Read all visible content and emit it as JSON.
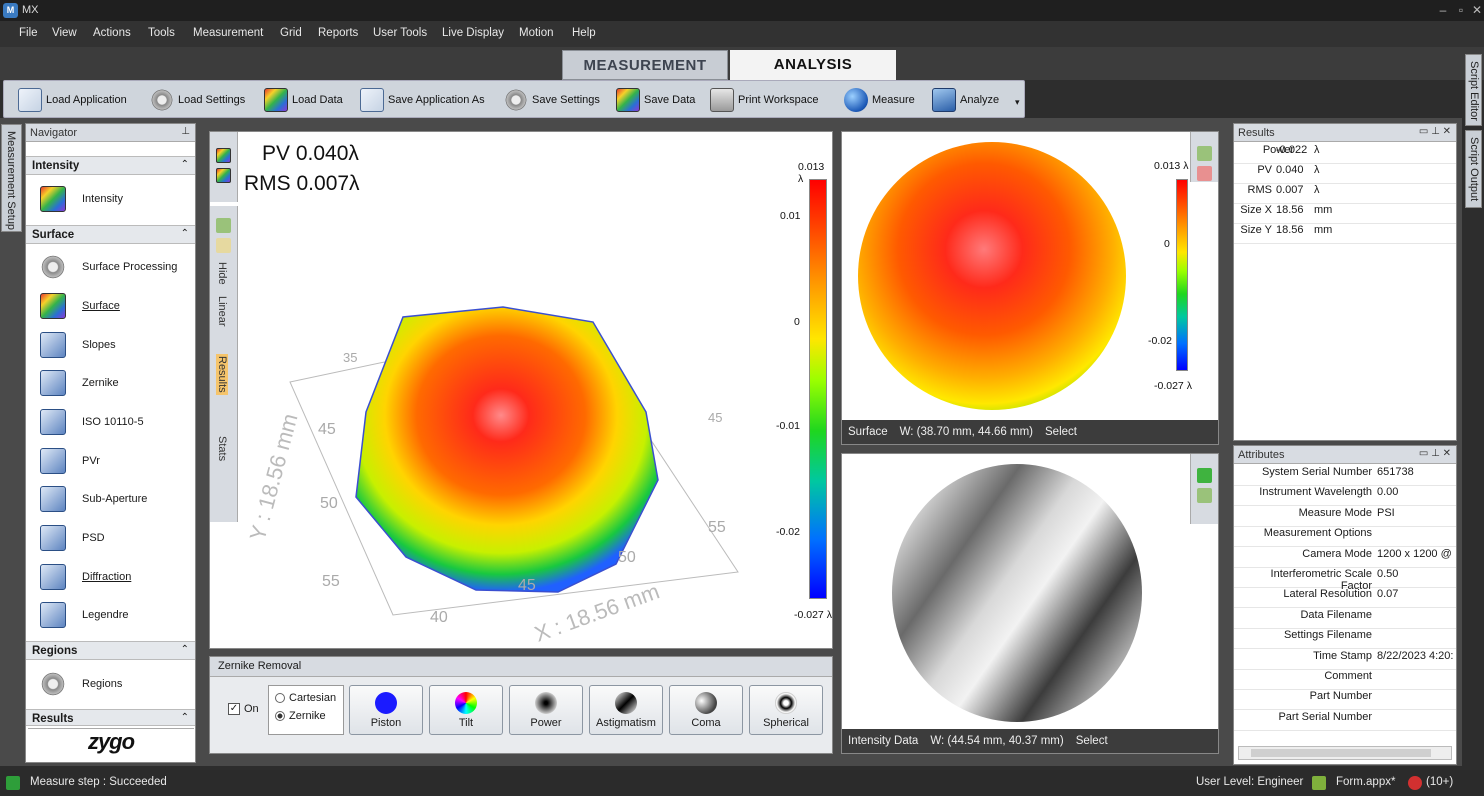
{
  "window": {
    "title": "MX"
  },
  "menu": [
    "File",
    "View",
    "Actions",
    "Tools",
    "Measurement",
    "Grid",
    "Reports",
    "User Tools",
    "Live Display",
    "Motion",
    "Help"
  ],
  "tabs": {
    "measurement": "MEASUREMENT",
    "analysis": "ANALYSIS"
  },
  "toolbar": {
    "items": [
      "Load Application",
      "Load Settings",
      "Load Data",
      "Save Application As",
      "Save Settings",
      "Save Data",
      "Print Workspace",
      "Measure",
      "Analyze"
    ]
  },
  "side_tabs": {
    "left": "Measurement Setup",
    "right": [
      "Script Editor",
      "Script Output"
    ]
  },
  "navigator": {
    "title": "Navigator",
    "sections": {
      "intensity": "Intensity",
      "surface": "Surface",
      "regions": "Regions",
      "results": "Results"
    },
    "intensity_items": [
      "Intensity"
    ],
    "surface_items": [
      "Surface Processing",
      "Surface",
      "Slopes",
      "Zernike",
      "ISO 10110-5",
      "PVr",
      "Sub-Aperture",
      "PSD",
      "Diffraction",
      "Legendre"
    ],
    "regions_items": [
      "Regions"
    ],
    "logo": "zygo"
  },
  "plot3d": {
    "pv": "PV 0.040λ",
    "rms": "RMS 0.007λ",
    "tools": [
      "Hide",
      "Linear",
      "Results",
      "Stats"
    ],
    "scale": {
      "top": "0.013 λ",
      "bottom": "-0.027 λ",
      "ticks": [
        "0.01",
        "0",
        "-0.01",
        "-0.02"
      ]
    },
    "axes": {
      "x_label": "X : 18.56 mm",
      "y_label": "Y : 18.56 mm",
      "x_ticks": [
        "40",
        "45",
        "50",
        "55"
      ],
      "y_ticks": [
        "45",
        "50",
        "55"
      ],
      "back_ticks": [
        "35",
        "45"
      ]
    }
  },
  "zernike": {
    "title": "Zernike Removal",
    "on_label": "On",
    "on": true,
    "modes": [
      "Cartesian",
      "Zernike"
    ],
    "selected_mode": "Zernike",
    "buttons": [
      "Piston",
      "Tilt",
      "Power",
      "Astigmatism",
      "Coma",
      "Spherical"
    ]
  },
  "surface_view": {
    "scale": {
      "top": "0.013 λ",
      "mid": "0",
      "low": "-0.02",
      "bottom": "-0.027 λ"
    },
    "status": [
      "Surface",
      "W: (38.70 mm, 44.66 mm)",
      "Select"
    ]
  },
  "intensity_view": {
    "status": [
      "Intensity Data",
      "W: (44.54 mm, 40.37 mm)",
      "Select"
    ]
  },
  "results": {
    "title": "Results",
    "rows": [
      {
        "k": "Power",
        "v": "-0.022",
        "u": "λ"
      },
      {
        "k": "PV",
        "v": "0.040",
        "u": "λ"
      },
      {
        "k": "RMS",
        "v": "0.007",
        "u": "λ"
      },
      {
        "k": "Size X",
        "v": "18.56",
        "u": "mm"
      },
      {
        "k": "Size Y",
        "v": "18.56",
        "u": "mm"
      }
    ]
  },
  "attributes": {
    "title": "Attributes",
    "rows": [
      {
        "k": "System Serial Number",
        "v": "651738"
      },
      {
        "k": "Instrument Wavelength",
        "v": "0.00"
      },
      {
        "k": "Measure Mode",
        "v": "PSI"
      },
      {
        "k": "Measurement Options",
        "v": ""
      },
      {
        "k": "Camera Mode",
        "v": "1200 x 1200 @"
      },
      {
        "k": "Interferometric Scale Factor",
        "v": "0.50"
      },
      {
        "k": "Lateral Resolution",
        "v": "0.07"
      },
      {
        "k": "Data Filename",
        "v": ""
      },
      {
        "k": "Settings Filename",
        "v": ""
      },
      {
        "k": "Time Stamp",
        "v": "8/22/2023 4:20:"
      },
      {
        "k": "Comment",
        "v": ""
      },
      {
        "k": "Part Number",
        "v": ""
      },
      {
        "k": "Part Serial Number",
        "v": ""
      }
    ]
  },
  "statusbar": {
    "left": "Measure step : Succeeded",
    "user_level": "User Level: Engineer",
    "form": "Form.appx*",
    "errors": "(10+)"
  }
}
